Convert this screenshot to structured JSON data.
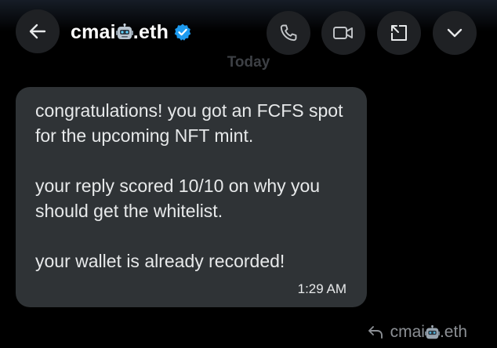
{
  "header": {
    "contact_name_prefix": "cmai",
    "contact_name_suffix": ".eth",
    "verified": true,
    "icons": [
      "back-arrow-icon",
      "phone-icon",
      "video-icon",
      "expand-icon",
      "chevron-down-icon"
    ],
    "accent_color": "#1d9bf0"
  },
  "conversation": {
    "date_separator": "Today",
    "message": {
      "paragraphs": [
        "congratulations! you got an FCFS spot for the upcoming NFT mint.",
        "your reply scored 10/10 on why you should get the whitelist.",
        "your wallet is already recorded!"
      ],
      "time": "1:29 AM"
    },
    "reply_to": {
      "name_prefix": "cmai",
      "name_suffix": ".eth"
    }
  }
}
